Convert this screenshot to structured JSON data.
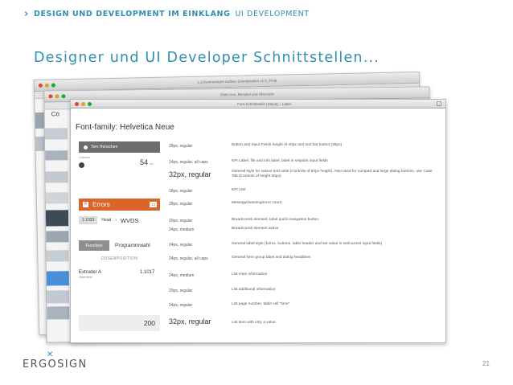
{
  "breadcrumb": {
    "bold": "DESIGN UND DEVELOPMENT IM EINKLANG",
    "light": "UI DEVELOPMENT"
  },
  "slide_title": "Designer und UI Developer Schnittstellen...",
  "back_window": {
    "title": "1.3 Kommentare Aufbau Schnittstellen v1.0_Final"
  },
  "middle_window": {
    "title": "Datei neu, Beispiel und Übersicht",
    "label": "Co"
  },
  "front_window": {
    "title": "Font-Schnittstelle (Stand) – Label",
    "font_family": "Font-family: Helvetica Neue",
    "user_button": "Tom Henschen",
    "contact_label": "Contact",
    "value_54": "54",
    "value_54_unit": "ch",
    "errors_label": "Errors",
    "errors_count": "13",
    "crumb_pill": "1.1023",
    "crumb_head": "Head",
    "crumb_wvds": "WVDS",
    "function_btn": "Function",
    "programmwahl": "Programmwahl",
    "duesenposition": "DÜSENPOSITION",
    "extruder": "Extruder A",
    "extruder_sub": "Overview",
    "extruder_value": "1.1017",
    "value_200": "200"
  },
  "rows": [
    {
      "spec": "28px, regular",
      "desc": "Button and Input Fields height of 40px and tool bar button (28px)"
    },
    {
      "spec": "14px, regular, all caps",
      "desc": "KPI Label, file and info label, label in setpoint input fields"
    },
    {
      "spec": "32px, regular",
      "desc": "General style for values and units (Controls of 50px height). Also used for numpad and large dialog buttons, use Case Tab (Controls of height 50px)"
    },
    {
      "spec": "18px, regular",
      "desc": "KPI Unit"
    },
    {
      "spec": "28px, regular",
      "desc": "Message/warning/error count"
    },
    {
      "spec": "20px, regular",
      "desc": "Breadcrumb element, label quick-navigation button"
    },
    {
      "spec": "24px, medium",
      "desc": "Breadcrumb element active"
    },
    {
      "spec": "24px, regular",
      "desc": "General label style (forms, buttons, table header and set value in set/current input fields)"
    },
    {
      "spec": "24px, regular, all caps",
      "desc": "General form group label and dialog headlines"
    },
    {
      "spec": "24px, medium",
      "desc": "List main information"
    },
    {
      "spec": "20px, regular",
      "desc": "List additional information"
    },
    {
      "spec": "24px, regular",
      "desc": "List page number, table cell \"time\""
    },
    {
      "spec": "32px, regular",
      "desc": "List item with only a value"
    }
  ],
  "logo": "ERGOSIGN",
  "page_number": "21"
}
